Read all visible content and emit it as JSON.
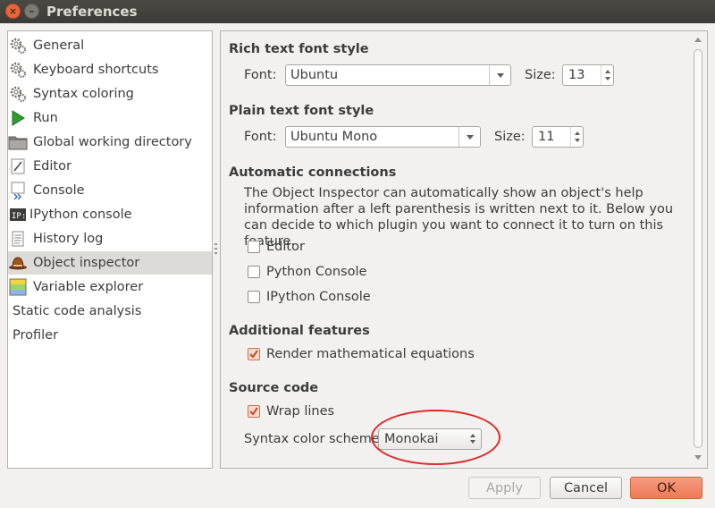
{
  "window": {
    "title": "Preferences"
  },
  "sidebar": {
    "items": [
      {
        "label": "General",
        "icon": "gear-icon"
      },
      {
        "label": "Keyboard shortcuts",
        "icon": "gear-icon"
      },
      {
        "label": "Syntax coloring",
        "icon": "gear-icon"
      },
      {
        "label": "Run",
        "icon": "run-play-icon"
      },
      {
        "label": "Global working directory",
        "icon": "folder-icon"
      },
      {
        "label": "Editor",
        "icon": "editor-icon"
      },
      {
        "label": "Console",
        "icon": "console-icon"
      },
      {
        "label": "IPython console",
        "icon": "ipython-icon"
      },
      {
        "label": "History log",
        "icon": "history-icon"
      },
      {
        "label": "Object inspector",
        "icon": "object-inspector-icon"
      },
      {
        "label": "Variable explorer",
        "icon": "variable-explorer-icon"
      },
      {
        "label": "Static code analysis",
        "icon": ""
      },
      {
        "label": "Profiler",
        "icon": ""
      }
    ],
    "selected": "Object inspector"
  },
  "content": {
    "rich_text": {
      "title": "Rich text font style",
      "font_label": "Font:",
      "font_value": "Ubuntu",
      "size_label": "Size:",
      "size_value": "13"
    },
    "plain_text": {
      "title": "Plain text font style",
      "font_label": "Font:",
      "font_value": "Ubuntu Mono",
      "size_label": "Size:",
      "size_value": "11"
    },
    "auto_connections": {
      "title": "Automatic connections",
      "description": "The Object Inspector can automatically show an object's help information after a left parenthesis is written next to it. Below you can decide to which plugin you want to connect it to turn on this feature.",
      "options": [
        {
          "label": "Editor",
          "checked": false
        },
        {
          "label": "Python Console",
          "checked": false
        },
        {
          "label": "IPython Console",
          "checked": false
        }
      ]
    },
    "additional": {
      "title": "Additional features",
      "render_math_label": "Render mathematical equations",
      "render_math_checked": true
    },
    "source_code": {
      "title": "Source code",
      "wrap_lines_label": "Wrap lines",
      "wrap_lines_checked": true,
      "scheme_label": "Syntax color scheme:",
      "scheme_value": "Monokai"
    }
  },
  "buttons": {
    "apply": "Apply",
    "cancel": "Cancel",
    "ok": "OK"
  },
  "colors": {
    "accent": "#ee7a55",
    "selection": "#dddbd8",
    "titlebar": "#3c3b37",
    "annotation": "#e32626"
  }
}
